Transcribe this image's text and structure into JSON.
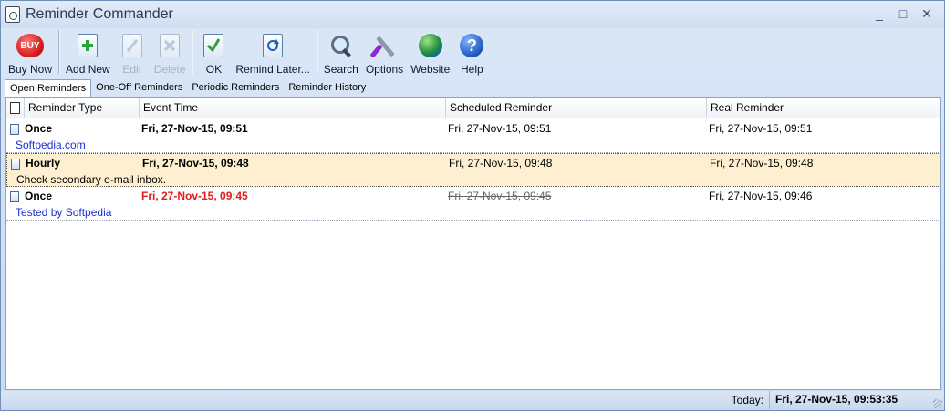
{
  "window": {
    "title": "Reminder Commander",
    "controls": [
      "_",
      "□",
      "✕"
    ]
  },
  "toolbar": {
    "buy_now": "Buy Now",
    "buy_badge": "BUY",
    "add_new": "Add New",
    "edit": "Edit",
    "delete": "Delete",
    "ok": "OK",
    "remind_later": "Remind Later...",
    "search": "Search",
    "options": "Options",
    "website": "Website",
    "help": "Help",
    "help_glyph": "?"
  },
  "tabs": [
    "Open Reminders",
    "One-Off Reminders",
    "Periodic Reminders",
    "Reminder History"
  ],
  "grid": {
    "columns": [
      "Reminder Type",
      "Event Time",
      "Scheduled Reminder",
      "Real Reminder"
    ],
    "rows": [
      {
        "type": "Once",
        "event_time": "Fri, 27-Nov-15, 09:51",
        "scheduled": "Fri, 27-Nov-15, 09:51",
        "real": "Fri, 27-Nov-15, 09:51",
        "note": "Softpedia.com"
      },
      {
        "type": "Hourly",
        "event_time": "Fri, 27-Nov-15, 09:48",
        "scheduled": "Fri, 27-Nov-15, 09:48",
        "real": "Fri, 27-Nov-15, 09:48",
        "note": "Check secondary e-mail inbox."
      },
      {
        "type": "Once",
        "event_time": "Fri, 27-Nov-15, 09:45",
        "scheduled": "Fri, 27-Nov-15, 09:45",
        "real": "Fri, 27-Nov-15, 09:46",
        "note": "Tested by Softpedia"
      }
    ]
  },
  "status": {
    "label": "Today:",
    "value": "Fri, 27-Nov-15, 09:53:35"
  },
  "colors": {
    "overdue": "#e41b1b",
    "note_link": "#1d2fd0",
    "selected_row": "#fdefcf"
  }
}
